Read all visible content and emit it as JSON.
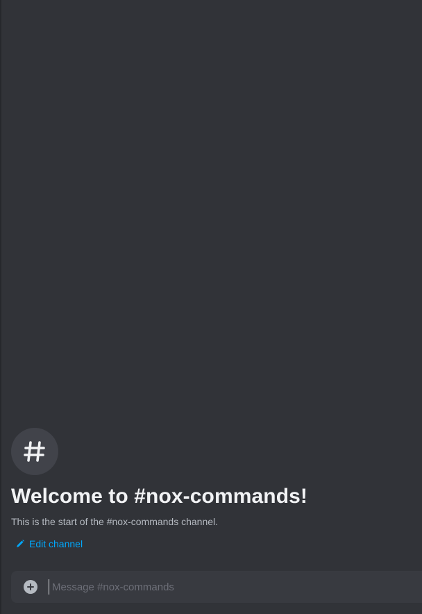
{
  "welcome": {
    "channel_icon": "hash-icon",
    "title": "Welcome to #nox-commands!",
    "subtitle": "This is the start of the #nox-commands channel.",
    "edit_icon": "pencil-icon",
    "edit_label": "Edit channel"
  },
  "composer": {
    "add_icon": "plus-circle-icon",
    "value": "",
    "placeholder": "Message #nox-commands"
  },
  "colors": {
    "background": "#313338",
    "icon_circle": "#41434a",
    "title": "#f2f3f5",
    "subtitle": "#b5bac1",
    "link": "#00a8fc",
    "composer": "#383a40",
    "placeholder": "#6d6f78"
  }
}
